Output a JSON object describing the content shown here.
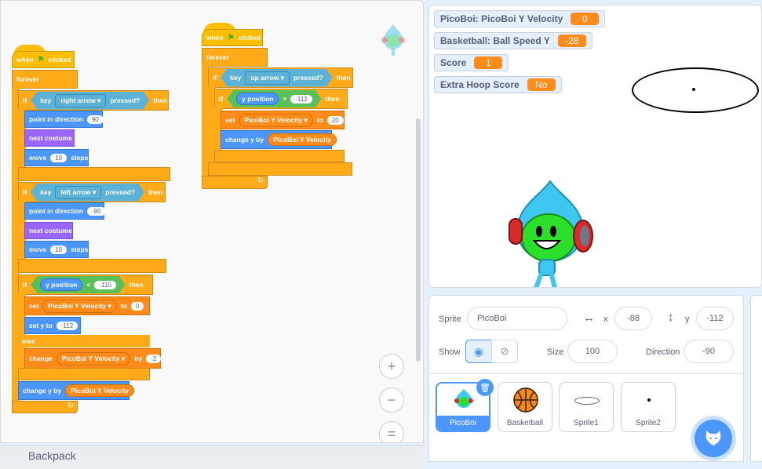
{
  "backpack": {
    "label": "Backpack"
  },
  "script1": {
    "hat": "when",
    "hat_tail": "clicked",
    "forever": "forever",
    "if1": {
      "if": "if",
      "key": "key",
      "key_name": "right arrow",
      "pressed": "pressed?",
      "then": "then"
    },
    "point1": {
      "label": "point in direction",
      "value": "90"
    },
    "costume1": "next costume",
    "move1": {
      "label": "move",
      "value": "10",
      "tail": "steps"
    },
    "if2": {
      "if": "if",
      "key": "key",
      "key_name": "left arrow",
      "pressed": "pressed?",
      "then": "then"
    },
    "point2": {
      "label": "point in direction",
      "value": "-90"
    },
    "costume2": "next costume",
    "move2": {
      "label": "move",
      "value": "10",
      "tail": "steps"
    },
    "if3": {
      "if": "if",
      "reporter": "y position",
      "op": "<",
      "value": "-110",
      "then": "then"
    },
    "set1": {
      "label": "set",
      "var": "PicoBoi Y Velocity",
      "to": "to",
      "value": "0"
    },
    "sety": {
      "label": "set y to",
      "value": "-112"
    },
    "else": "else",
    "change1": {
      "label": "change",
      "var": "PicoBoi Y Velocity",
      "by": "by",
      "value": "-2"
    },
    "changey": {
      "label": "change y by",
      "var": "PicoBoi Y Velocity"
    }
  },
  "script2": {
    "hat": "when",
    "hat_tail": "clicked",
    "forever": "forever",
    "if1": {
      "if": "if",
      "key": "key",
      "key_name": "up arrow",
      "pressed": "pressed?",
      "then": "then"
    },
    "if2": {
      "if": "if",
      "reporter": "y position",
      "op": "=",
      "value": "-112",
      "then": "then"
    },
    "set1": {
      "label": "set",
      "var": "PicoBoi Y Velocity",
      "to": "to",
      "value": "20"
    },
    "changey": {
      "label": "change y by",
      "var": "PicoBoi Y Velocity"
    }
  },
  "zoom": {
    "in": "+",
    "out": "−",
    "reset": "="
  },
  "monitors": [
    {
      "label": "PicoBoi: PicoBoi Y Velocity",
      "value": "0"
    },
    {
      "label": "Basketball: Ball Speed Y",
      "value": "-28"
    },
    {
      "label": "Score",
      "value": "1"
    },
    {
      "label": "Extra Hoop Score",
      "value": "No"
    }
  ],
  "sprite_info": {
    "sprite_label": "Sprite",
    "sprite_name": "PicoBoi",
    "x_label": "x",
    "x_value": "-88",
    "y_label": "y",
    "y_value": "-112",
    "show_label": "Show",
    "size_label": "Size",
    "size_value": "100",
    "direction_label": "Direction",
    "direction_value": "-90"
  },
  "sprites": [
    {
      "name": "PicoBoi"
    },
    {
      "name": "Basketball"
    },
    {
      "name": "Sprite1"
    },
    {
      "name": "Sprite2"
    }
  ],
  "colors": {
    "control": "#ffab19",
    "events": "#ffbf00",
    "motion": "#4c97ff",
    "looks": "#9966ff",
    "variables": "#ff8c1a",
    "sensing": "#5cb1d6",
    "operators": "#59c059",
    "selected": "#4c97ff"
  }
}
